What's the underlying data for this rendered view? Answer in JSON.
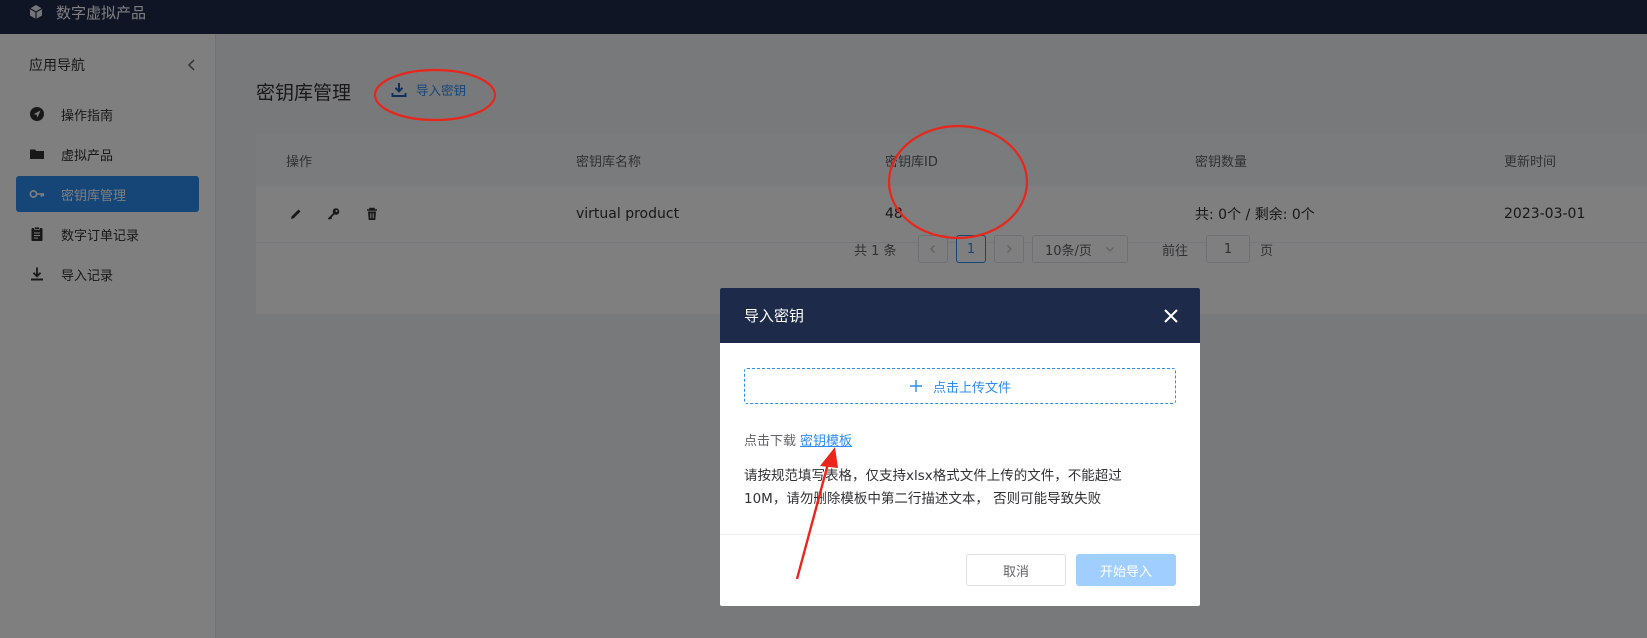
{
  "header": {
    "app_title": "数字虚拟产品",
    "logo_icon": "cube-icon"
  },
  "sidebar": {
    "title": "应用导航",
    "collapse_icon": "chevron-left-icon",
    "items": [
      {
        "label": "操作指南",
        "icon": "navigation-icon",
        "active": false
      },
      {
        "label": "虚拟产品",
        "icon": "folder-icon",
        "active": false
      },
      {
        "label": "密钥库管理",
        "icon": "key-icon",
        "active": true
      },
      {
        "label": "数字订单记录",
        "icon": "clipboard-icon",
        "active": false
      },
      {
        "label": "导入记录",
        "icon": "download-icon",
        "active": false
      }
    ]
  },
  "page": {
    "title": "密钥库管理",
    "import_label": "导入密钥"
  },
  "table": {
    "columns": [
      "操作",
      "密钥库名称",
      "密钥库ID",
      "密钥数量",
      "更新时间"
    ],
    "rows": [
      {
        "name": "virtual product",
        "id": "48",
        "count": "共: 0个 / 剩余: 0个",
        "updated": "2023-03-01"
      }
    ]
  },
  "pagination": {
    "total": "共 1 条",
    "current_page": "1",
    "page_size": "10条/页",
    "goto_prefix": "前往",
    "goto_value": "1",
    "goto_suffix": "页"
  },
  "modal": {
    "title": "导入密钥",
    "upload_label": "点击上传文件",
    "download_prefix": "点击下载",
    "template_link": "密钥模板",
    "notice": "请按规范填写表格，仅支持xlsx格式文件上传的文件，不能超过10M，请勿删除模板中第二行描述文本， 否则可能导致失败",
    "cancel_label": "取消",
    "start_label": "开始导入"
  },
  "colors": {
    "header_bg": "#1e2a4a",
    "primary": "#2d8cf0",
    "disabled_primary": "#a0cfff",
    "annotation_red": "#e8261c"
  }
}
